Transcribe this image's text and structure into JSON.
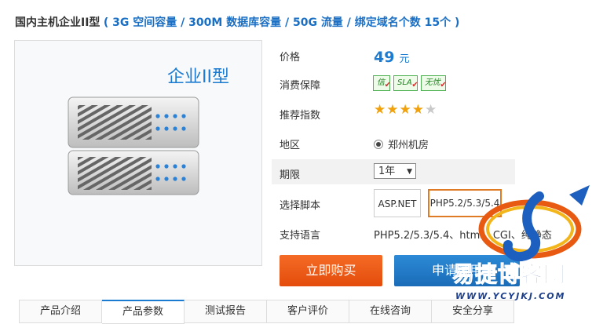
{
  "page": {
    "product_title": "国内主机企业II型",
    "product_spec": "( 3G 空间容量 / 300M 数据库容量 / 50G 流量 / 绑定域名个数 15个 )"
  },
  "product_image": {
    "label": "企业II型"
  },
  "rows": {
    "price_label": "价格",
    "price_value": "49",
    "price_unit": "元",
    "guarantee_label": "消费保障",
    "guarantee_badges": [
      "信",
      "SLA",
      "无忧"
    ],
    "rating_label": "推荐指数",
    "rating_value": 4.5,
    "region_label": "地区",
    "region_value": "郑州机房",
    "period_label": "期限",
    "period_value": "1年",
    "script_label": "选择脚本",
    "script_options": [
      "ASP.NET",
      "PHP5.2/5.3/5.4"
    ],
    "script_selected": "PHP5.2/5.3/5.4",
    "language_label": "支持语言",
    "language_value": "PHP5.2/5.3/5.4、html、CGI、纯静态"
  },
  "actions": {
    "buy_label": "立即购买",
    "trial_label": "申请试用"
  },
  "tabs": [
    "产品介绍",
    "产品参数",
    "测试报告",
    "客户评价",
    "在线咨询",
    "安全分享"
  ],
  "active_tab": "产品参数",
  "watermark": {
    "text": "易捷博客网",
    "url": "WWW.YCYJKJ.COM"
  },
  "colors": {
    "accent": "#1a7bd1",
    "buy": "#e8541a",
    "selected_border": "#e07b25"
  },
  "icons": {
    "guarantee": "verified-check-icon",
    "rating": "star-icon",
    "region": "radio-icon"
  }
}
